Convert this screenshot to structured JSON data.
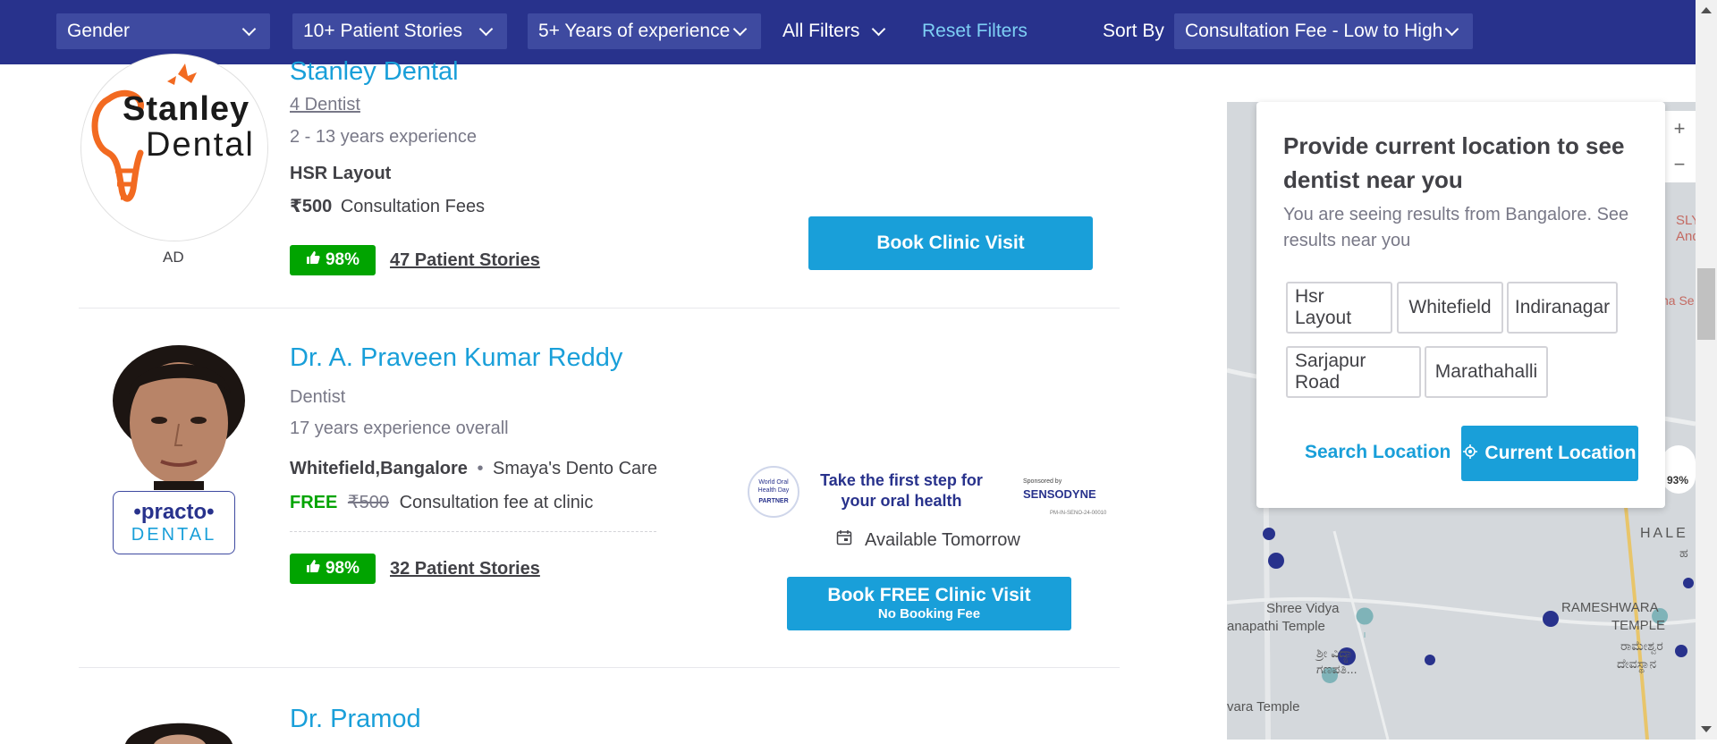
{
  "filters": {
    "gender": "Gender",
    "patient_stories": "10+ Patient Stories",
    "experience": "5+ Years of experience",
    "all_filters": "All Filters",
    "reset": "Reset Filters",
    "sort_label": "Sort By",
    "sort_value": "Consultation Fee - Low to High"
  },
  "listings": [
    {
      "name": "Stanley Dental",
      "logo_text_1": "Stanley",
      "logo_text_2": "Dental",
      "badge": "AD",
      "subtitle": "4 Dentist",
      "experience": "2 - 13 years experience",
      "location": "HSR Layout",
      "fee_amount": "₹500",
      "fee_label": "Consultation Fees",
      "rating": "98%",
      "stories": "47 Patient Stories",
      "button": "Book Clinic Visit"
    },
    {
      "name": "Dr. A. Praveen Kumar Reddy",
      "practo_1": "•practo•",
      "practo_2": "DENTAL",
      "specialty": "Dentist",
      "experience": "17 years experience overall",
      "location": "Whitefield,Bangalore",
      "clinic": "Smaya's Dento Care",
      "fee_free": "FREE",
      "fee_old": "₹500",
      "fee_label": "Consultation fee at clinic",
      "rating": "98%",
      "stories": "32 Patient Stories",
      "sponsor_text_1": "Take the first step for",
      "sponsor_text_2": "your oral health",
      "sponsor_badge_1": "World Oral",
      "sponsor_badge_2": "Health Day",
      "sponsor_badge_3": "PARTNER",
      "sponsor_brand_top": "Sponsored by",
      "sponsor_brand": "SENSODYNE",
      "sponsor_code": "PM-IN-SENO-24-00010",
      "availability": "Available Tomorrow",
      "button": "Book FREE Clinic Visit",
      "button_sub": "No Booking Fee"
    },
    {
      "name": "Dr. Pramod"
    }
  ],
  "location_panel": {
    "title": "Provide current location to see dentist near you",
    "subtitle": "You are seeing results from Bangalore. See results near you",
    "chips": [
      "Hsr Layout",
      "Whitefield",
      "Indiranagar",
      "Sarjapur Road",
      "Marathahalli"
    ],
    "search": "Search Location",
    "current": "Current Location"
  },
  "map": {
    "zoom_in": "+",
    "zoom_out": "−",
    "label_sly": "SLY",
    "label_and": "And",
    "label_na": "na Se",
    "label_hale": "HALE",
    "label_ka": "ಹ",
    "label_shree_1": "Shree Vidya",
    "label_shree_2": "anapathi Temple",
    "label_shree_kn_1": "ಶ್ರೀ ವಿದ್ಯಾ",
    "label_shree_kn_2": "ಗಣಪತಿ...",
    "label_rame_1": "RAMESHWARA",
    "label_rame_2": "TEMPLE",
    "label_rame_kn_1": "ರಾಮೇಶ್ವರ",
    "label_rame_kn_2": "ದೇವಸ್ಥಾನ",
    "label_vara": "vara Temple",
    "pin_rating": "93%"
  }
}
